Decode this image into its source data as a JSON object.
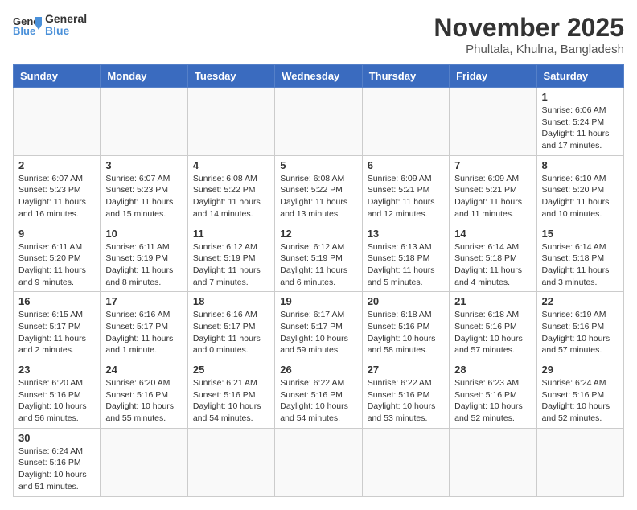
{
  "header": {
    "logo_general": "General",
    "logo_blue": "Blue",
    "month_title": "November 2025",
    "location": "Phultala, Khulna, Bangladesh"
  },
  "weekdays": [
    "Sunday",
    "Monday",
    "Tuesday",
    "Wednesday",
    "Thursday",
    "Friday",
    "Saturday"
  ],
  "weeks": [
    [
      {
        "day": "",
        "info": ""
      },
      {
        "day": "",
        "info": ""
      },
      {
        "day": "",
        "info": ""
      },
      {
        "day": "",
        "info": ""
      },
      {
        "day": "",
        "info": ""
      },
      {
        "day": "",
        "info": ""
      },
      {
        "day": "1",
        "info": "Sunrise: 6:06 AM\nSunset: 5:24 PM\nDaylight: 11 hours and 17 minutes."
      }
    ],
    [
      {
        "day": "2",
        "info": "Sunrise: 6:07 AM\nSunset: 5:23 PM\nDaylight: 11 hours and 16 minutes."
      },
      {
        "day": "3",
        "info": "Sunrise: 6:07 AM\nSunset: 5:23 PM\nDaylight: 11 hours and 15 minutes."
      },
      {
        "day": "4",
        "info": "Sunrise: 6:08 AM\nSunset: 5:22 PM\nDaylight: 11 hours and 14 minutes."
      },
      {
        "day": "5",
        "info": "Sunrise: 6:08 AM\nSunset: 5:22 PM\nDaylight: 11 hours and 13 minutes."
      },
      {
        "day": "6",
        "info": "Sunrise: 6:09 AM\nSunset: 5:21 PM\nDaylight: 11 hours and 12 minutes."
      },
      {
        "day": "7",
        "info": "Sunrise: 6:09 AM\nSunset: 5:21 PM\nDaylight: 11 hours and 11 minutes."
      },
      {
        "day": "8",
        "info": "Sunrise: 6:10 AM\nSunset: 5:20 PM\nDaylight: 11 hours and 10 minutes."
      }
    ],
    [
      {
        "day": "9",
        "info": "Sunrise: 6:11 AM\nSunset: 5:20 PM\nDaylight: 11 hours and 9 minutes."
      },
      {
        "day": "10",
        "info": "Sunrise: 6:11 AM\nSunset: 5:19 PM\nDaylight: 11 hours and 8 minutes."
      },
      {
        "day": "11",
        "info": "Sunrise: 6:12 AM\nSunset: 5:19 PM\nDaylight: 11 hours and 7 minutes."
      },
      {
        "day": "12",
        "info": "Sunrise: 6:12 AM\nSunset: 5:19 PM\nDaylight: 11 hours and 6 minutes."
      },
      {
        "day": "13",
        "info": "Sunrise: 6:13 AM\nSunset: 5:18 PM\nDaylight: 11 hours and 5 minutes."
      },
      {
        "day": "14",
        "info": "Sunrise: 6:14 AM\nSunset: 5:18 PM\nDaylight: 11 hours and 4 minutes."
      },
      {
        "day": "15",
        "info": "Sunrise: 6:14 AM\nSunset: 5:18 PM\nDaylight: 11 hours and 3 minutes."
      }
    ],
    [
      {
        "day": "16",
        "info": "Sunrise: 6:15 AM\nSunset: 5:17 PM\nDaylight: 11 hours and 2 minutes."
      },
      {
        "day": "17",
        "info": "Sunrise: 6:16 AM\nSunset: 5:17 PM\nDaylight: 11 hours and 1 minute."
      },
      {
        "day": "18",
        "info": "Sunrise: 6:16 AM\nSunset: 5:17 PM\nDaylight: 11 hours and 0 minutes."
      },
      {
        "day": "19",
        "info": "Sunrise: 6:17 AM\nSunset: 5:17 PM\nDaylight: 10 hours and 59 minutes."
      },
      {
        "day": "20",
        "info": "Sunrise: 6:18 AM\nSunset: 5:16 PM\nDaylight: 10 hours and 58 minutes."
      },
      {
        "day": "21",
        "info": "Sunrise: 6:18 AM\nSunset: 5:16 PM\nDaylight: 10 hours and 57 minutes."
      },
      {
        "day": "22",
        "info": "Sunrise: 6:19 AM\nSunset: 5:16 PM\nDaylight: 10 hours and 57 minutes."
      }
    ],
    [
      {
        "day": "23",
        "info": "Sunrise: 6:20 AM\nSunset: 5:16 PM\nDaylight: 10 hours and 56 minutes."
      },
      {
        "day": "24",
        "info": "Sunrise: 6:20 AM\nSunset: 5:16 PM\nDaylight: 10 hours and 55 minutes."
      },
      {
        "day": "25",
        "info": "Sunrise: 6:21 AM\nSunset: 5:16 PM\nDaylight: 10 hours and 54 minutes."
      },
      {
        "day": "26",
        "info": "Sunrise: 6:22 AM\nSunset: 5:16 PM\nDaylight: 10 hours and 54 minutes."
      },
      {
        "day": "27",
        "info": "Sunrise: 6:22 AM\nSunset: 5:16 PM\nDaylight: 10 hours and 53 minutes."
      },
      {
        "day": "28",
        "info": "Sunrise: 6:23 AM\nSunset: 5:16 PM\nDaylight: 10 hours and 52 minutes."
      },
      {
        "day": "29",
        "info": "Sunrise: 6:24 AM\nSunset: 5:16 PM\nDaylight: 10 hours and 52 minutes."
      }
    ],
    [
      {
        "day": "30",
        "info": "Sunrise: 6:24 AM\nSunset: 5:16 PM\nDaylight: 10 hours and 51 minutes."
      },
      {
        "day": "",
        "info": ""
      },
      {
        "day": "",
        "info": ""
      },
      {
        "day": "",
        "info": ""
      },
      {
        "day": "",
        "info": ""
      },
      {
        "day": "",
        "info": ""
      },
      {
        "day": "",
        "info": ""
      }
    ]
  ]
}
